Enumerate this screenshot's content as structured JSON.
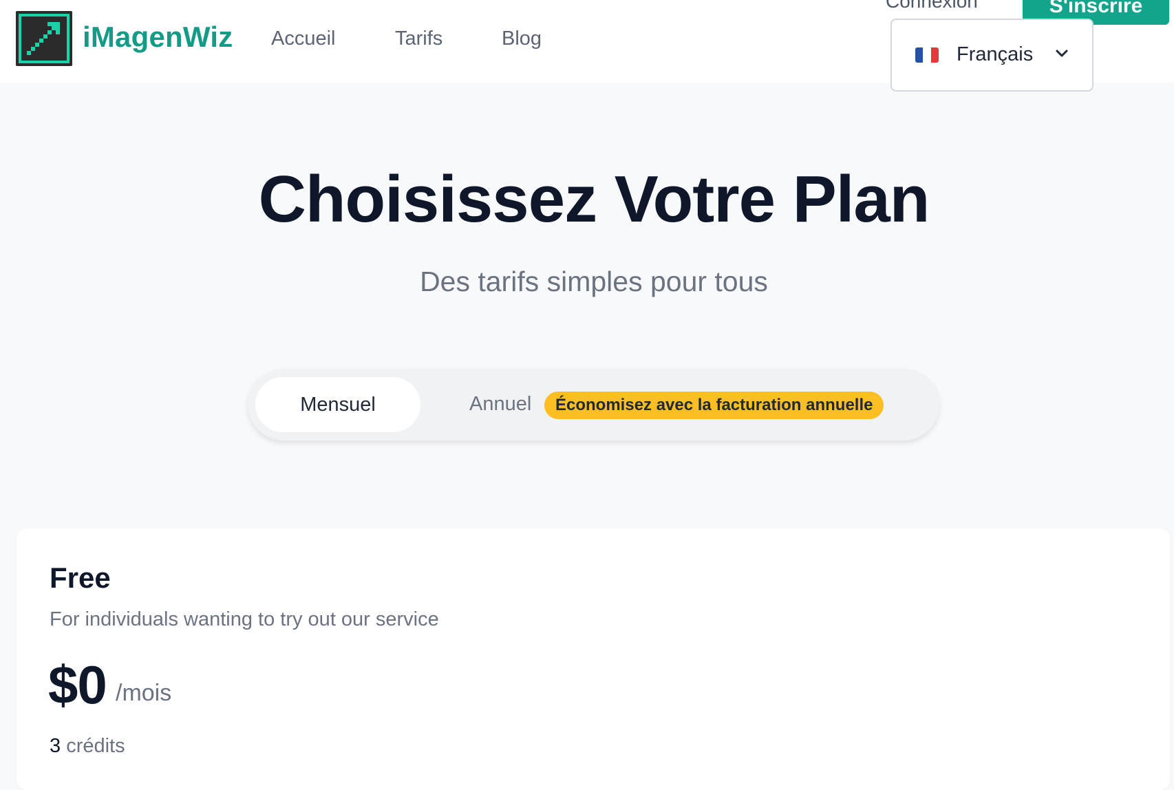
{
  "header": {
    "brand": "iMagenWiz",
    "logo_icon": "trend-up-arrow-icon",
    "brand_color": "#149b86",
    "nav": [
      {
        "label": "Accueil"
      },
      {
        "label": "Tarifs"
      },
      {
        "label": "Blog"
      }
    ],
    "login_label": "Connexion",
    "signup_label": "S'inscrire",
    "signup_color": "#13a58c",
    "language": {
      "flag_icon": "france-flag-icon",
      "selected": "Français",
      "chevron_icon": "chevron-down-icon"
    }
  },
  "hero": {
    "title": "Choisissez Votre Plan",
    "subtitle": "Des tarifs simples pour tous"
  },
  "billing": {
    "monthly_label": "Mensuel",
    "annual_label": "Annuel",
    "annual_badge": "Économisez avec la facturation annuelle",
    "badge_color": "#fbbf24",
    "selected": "Mensuel"
  },
  "plans": [
    {
      "name": "Free",
      "description": "For individuals wanting to try out our service",
      "price": "$0",
      "period": "/mois",
      "credits_value": "3",
      "credits_label": "crédits"
    }
  ]
}
